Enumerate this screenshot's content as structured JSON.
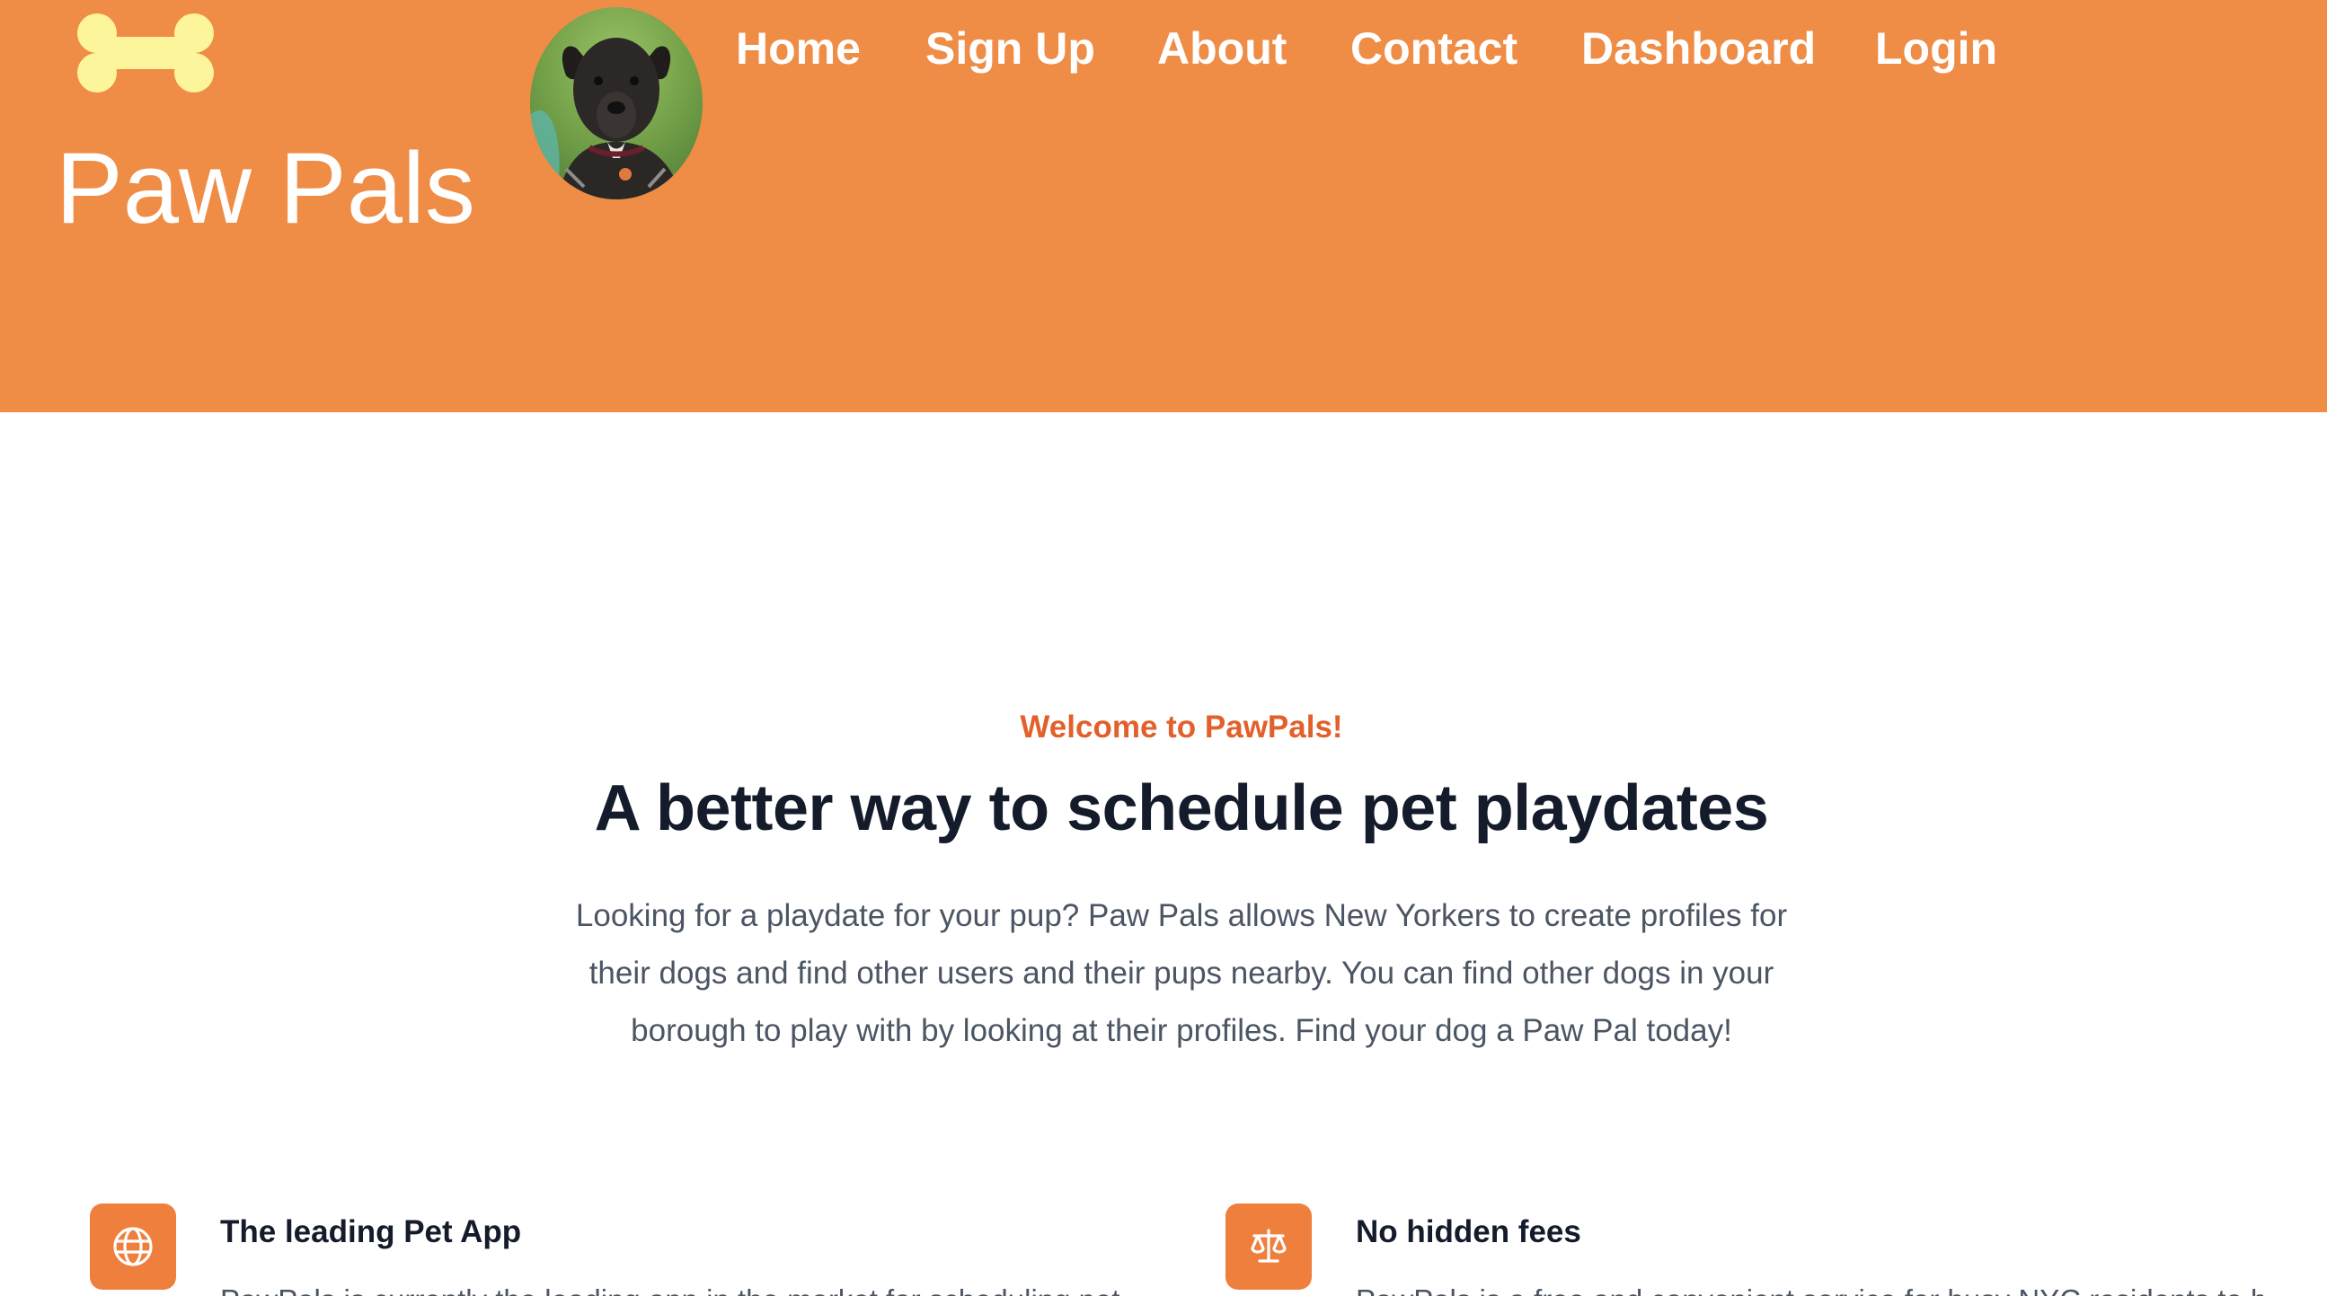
{
  "header": {
    "brand": "Paw Pals",
    "logo_icon": "bone-icon",
    "avatar_alt": "dog-photo",
    "colors": {
      "background": "#EF8C46",
      "text": "#FFFFFF",
      "bone": "#FDF59B"
    }
  },
  "nav": {
    "items": [
      {
        "label": "Home"
      },
      {
        "label": "Sign Up"
      },
      {
        "label": "About"
      },
      {
        "label": "Contact"
      },
      {
        "label": "Dashboard"
      },
      {
        "label": "Login"
      }
    ]
  },
  "hero": {
    "eyebrow": "Welcome to PawPals!",
    "title": "A better way to schedule pet playdates",
    "body": "Looking for a playdate for your pup? Paw Pals allows New Yorkers to create profiles for their dogs and find other users and their pups nearby. You can find other dogs in your borough to play with by looking at their profiles. Find your dog a Paw Pal today!",
    "colors": {
      "eyebrow": "#E1602B",
      "title": "#141B2B",
      "body": "#4B5563"
    }
  },
  "features": [
    {
      "icon": "globe-icon",
      "title": "The leading Pet App",
      "text": "PawPals is currently the leading app in the market for scheduling pet"
    },
    {
      "icon": "scale-icon",
      "title": "No hidden fees",
      "text": "PawPals is a free and convenient service for busy NYC residents to be"
    }
  ],
  "feature_icon_color": "#EF7F3C"
}
